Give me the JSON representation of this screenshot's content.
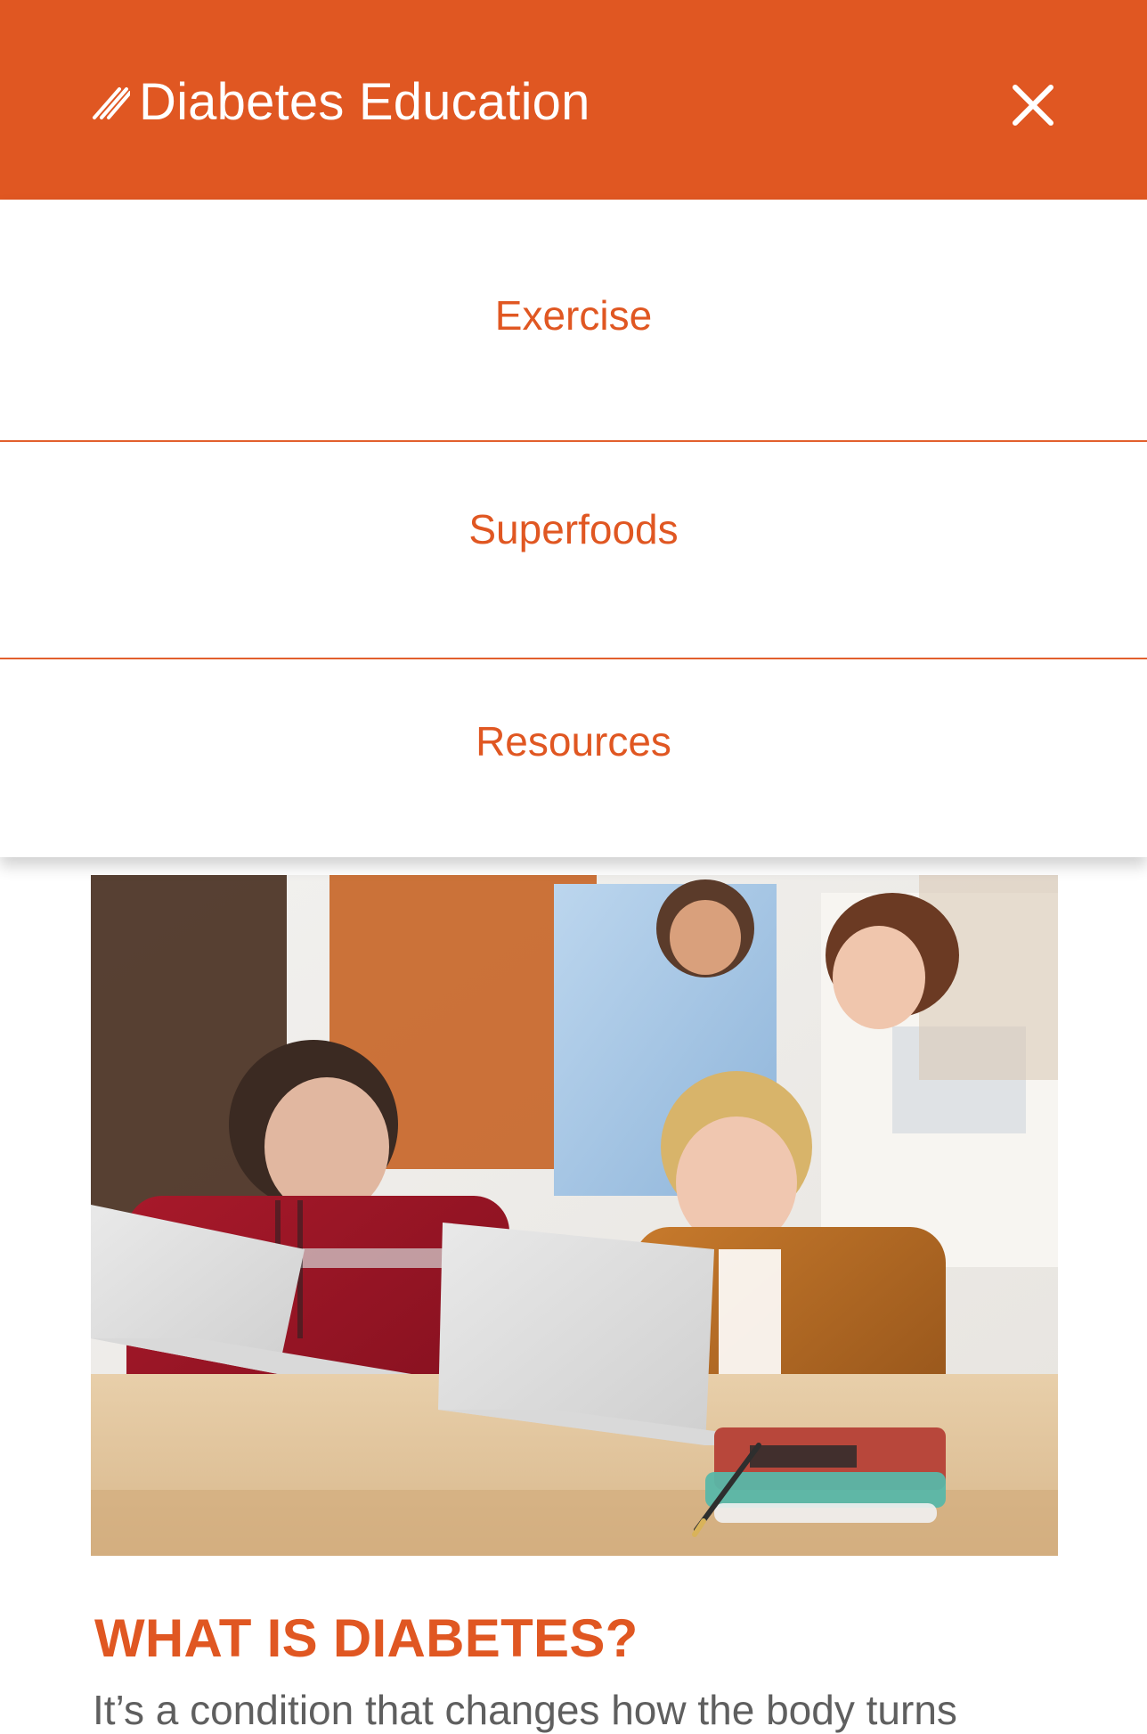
{
  "header": {
    "title": "Diabetes Education",
    "brand_icon": "slashes-logo-icon",
    "close_icon": "close-icon"
  },
  "menu": {
    "items": [
      {
        "label": "Exercise"
      },
      {
        "label": "Superfoods"
      },
      {
        "label": "Resources"
      }
    ]
  },
  "content": {
    "hero_image_icon": "students-with-laptops-image",
    "headline": "WHAT IS DIABETES?",
    "intro": "It’s a condition that changes how the body turns"
  },
  "colors": {
    "brand": "#E05722",
    "white": "#FFFFFF",
    "text": "#5F5F5F"
  }
}
